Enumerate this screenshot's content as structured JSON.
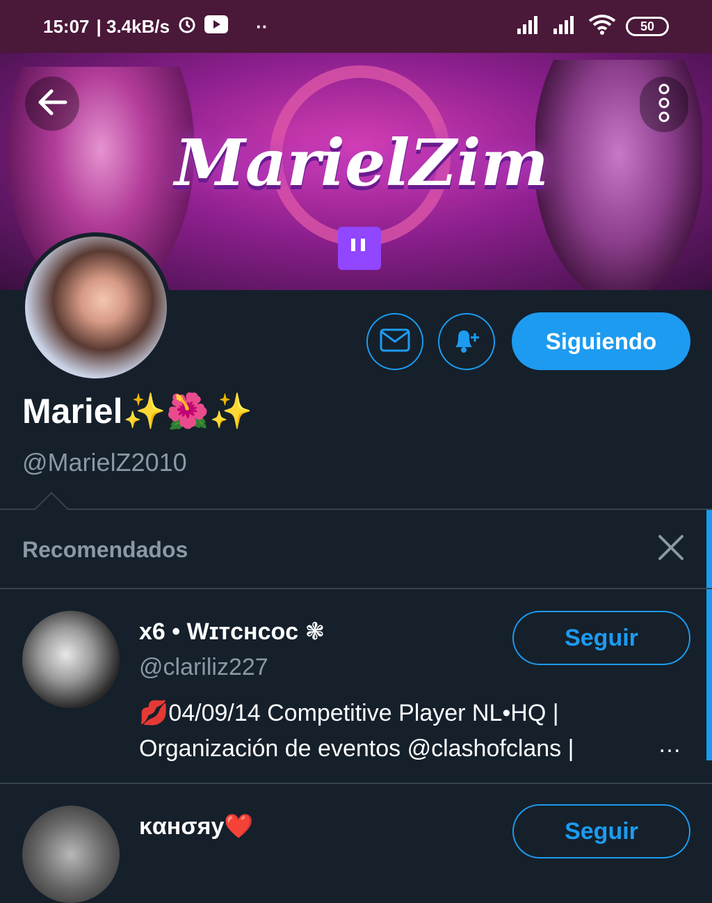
{
  "status_bar": {
    "time": "15:07",
    "net_speed": "| 3.4kB/s",
    "extra_dots": "··",
    "battery": "50"
  },
  "banner": {
    "title": "MarielZim"
  },
  "profile": {
    "display_name": "Mariel✨🌺✨",
    "handle": "@MarielZ2010",
    "following_label": "Siguiendo"
  },
  "recommended": {
    "header": "Recomendados",
    "users": [
      {
        "name": "x6 • Wɪᴛᴄʜᴄᴏᴄ ❃",
        "handle": "@clariliz227",
        "bio_line1": "💋04/09/14 Competitive Player NL•HQ |",
        "bio_line2": "Organización de eventos @clashofclans |",
        "bio_more": "…",
        "follow_label": "Seguir"
      },
      {
        "name": "ĸαнσяу❤️",
        "follow_label": "Seguir"
      }
    ]
  },
  "colors": {
    "accent": "#1d9bf0",
    "background": "#15202b",
    "status_bar": "#4a1838",
    "muted_text": "#8b98a5"
  }
}
